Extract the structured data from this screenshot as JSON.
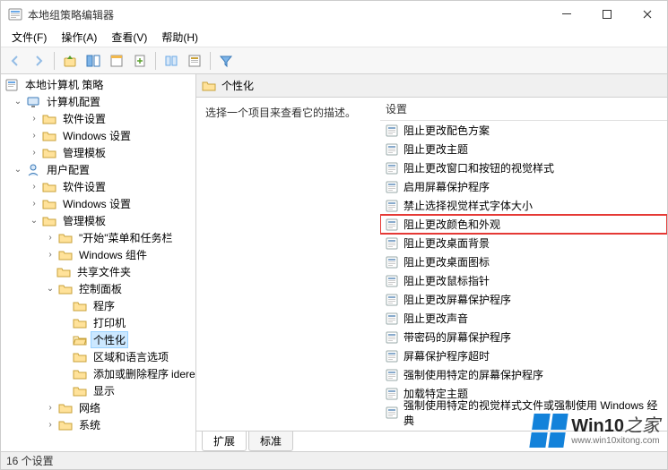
{
  "window": {
    "title": "本地组策略编辑器"
  },
  "menus": [
    {
      "label": "文件(F)"
    },
    {
      "label": "操作(A)"
    },
    {
      "label": "查看(V)"
    },
    {
      "label": "帮助(H)"
    }
  ],
  "tree": {
    "root": "本地计算机 策略",
    "computer": {
      "label": "计算机配置",
      "children": [
        {
          "label": "软件设置"
        },
        {
          "label": "Windows 设置"
        },
        {
          "label": "管理模板"
        }
      ]
    },
    "user": {
      "label": "用户配置",
      "children": [
        {
          "label": "软件设置"
        },
        {
          "label": "Windows 设置"
        },
        {
          "label": "管理模板",
          "children": [
            {
              "label": "\"开始\"菜单和任务栏"
            },
            {
              "label": "Windows 组件"
            },
            {
              "label": "共享文件夹"
            },
            {
              "label": "控制面板",
              "children": [
                {
                  "label": "程序"
                },
                {
                  "label": "打印机"
                },
                {
                  "label": "个性化",
                  "selected": true
                },
                {
                  "label": "区域和语言选项"
                },
                {
                  "label": "添加或删除程序"
                },
                {
                  "label": "显示"
                }
              ]
            },
            {
              "label": "网络"
            },
            {
              "label": "系统"
            }
          ]
        }
      ]
    }
  },
  "right": {
    "path": "个性化",
    "description": "选择一个项目来查看它的描述。",
    "column": "设置",
    "items": [
      "阻止更改配色方案",
      "阻止更改主题",
      "阻止更改窗口和按钮的视觉样式",
      "启用屏幕保护程序",
      "禁止选择视觉样式字体大小",
      "阻止更改颜色和外观",
      "阻止更改桌面背景",
      "阻止更改桌面图标",
      "阻止更改鼠标指针",
      "阻止更改屏幕保护程序",
      "阻止更改声音",
      "带密码的屏幕保护程序",
      "屏幕保护程序超时",
      "强制使用特定的屏幕保护程序",
      "加载特定主题",
      "强制使用特定的视觉样式文件或强制使用 Windows 经典"
    ],
    "highlight_index": 5,
    "tabs": {
      "extended": "扩展",
      "standard": "标准"
    }
  },
  "status": "16 个设置",
  "watermark": {
    "line1a": "Win10",
    "line1b": "之家",
    "line2": "www.win10xitong.com"
  }
}
